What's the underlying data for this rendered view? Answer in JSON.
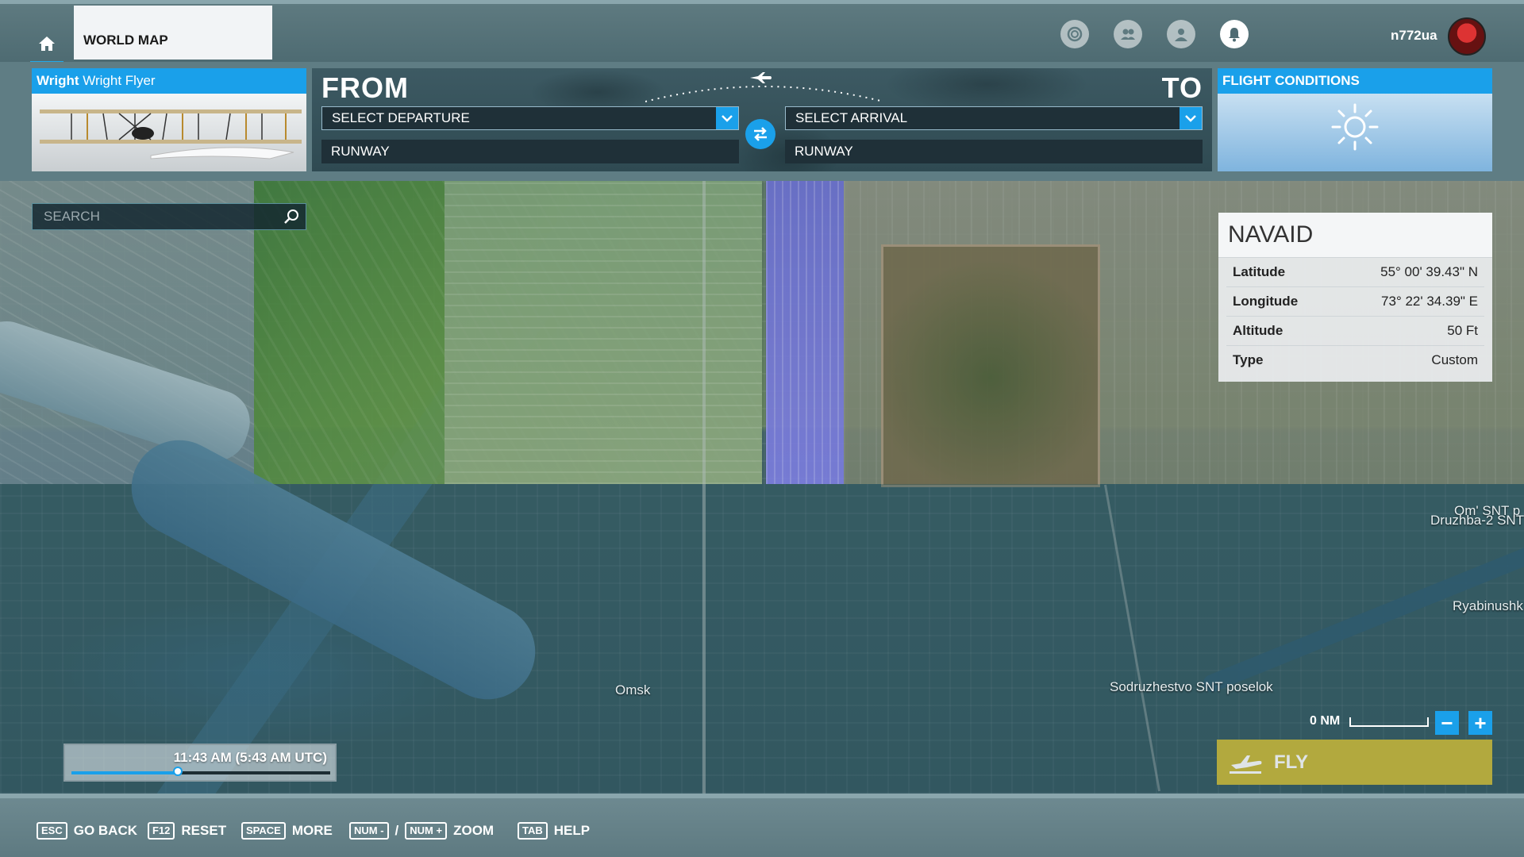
{
  "topbar": {
    "home_icon": "home-icon",
    "tab_label": "WORLD MAP",
    "icons": [
      "activity-icon",
      "friends-icon",
      "profile-icon",
      "notifications-icon"
    ],
    "username": "n772ua"
  },
  "aircraft": {
    "brand": "Wright",
    "model": "Wright Flyer"
  },
  "route": {
    "from_label": "FROM",
    "to_label": "TO",
    "departure_placeholder": "SELECT DEPARTURE",
    "arrival_placeholder": "SELECT ARRIVAL",
    "departure_runway": "RUNWAY",
    "arrival_runway": "RUNWAY",
    "swap_icon": "swap-icon"
  },
  "conditions": {
    "title": "FLIGHT CONDITIONS",
    "weather_icon": "sun-icon"
  },
  "search": {
    "placeholder": "SEARCH"
  },
  "navaid": {
    "title": "NAVAID",
    "rows": [
      {
        "key": "Latitude",
        "value": "55° 00' 39.43\" N"
      },
      {
        "key": "Longitude",
        "value": "73° 22' 34.39\" E"
      },
      {
        "key": "Altitude",
        "value": "50 Ft"
      },
      {
        "key": "Type",
        "value": "Custom"
      }
    ]
  },
  "map_labels": {
    "omsk": "Omsk",
    "sodruzhestvo": "Sodruzhestvo SNT poselok",
    "druzhba": "Druzhba-2 SNT",
    "om_snt": "Om' SNT p",
    "ryabinushka": "Ryabinushk"
  },
  "scale": {
    "label": "0 NM",
    "zoom_out": "−",
    "zoom_in": "+"
  },
  "time": {
    "label": "11:43 AM (5:43 AM UTC)",
    "slider_fraction": 0.41
  },
  "fly": {
    "label": "FLY"
  },
  "bottombar": {
    "esc_key": "ESC",
    "esc_label": "GO BACK",
    "f12_key": "F12",
    "f12_label": "RESET",
    "space_key": "SPACE",
    "space_label": "MORE",
    "num_minus_key": "NUM -",
    "num_plus_key": "NUM +",
    "zoom_sep": "/",
    "zoom_label": "ZOOM",
    "tab_key": "TAB",
    "tab_label": "HELP"
  },
  "colors": {
    "accent": "#1aa0ea",
    "fly_button": "#b2a93e"
  }
}
